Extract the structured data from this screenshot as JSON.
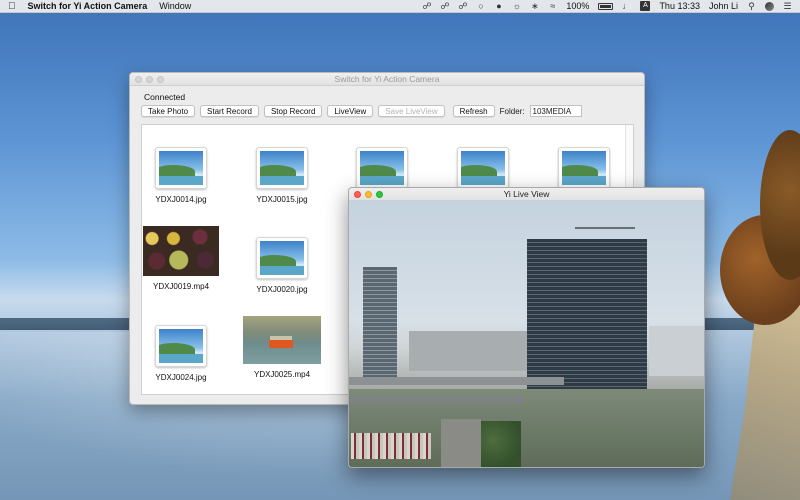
{
  "menubar": {
    "apple_icon": "apple-icon",
    "app_name": "Switch for Yi Action Camera",
    "menus": [
      "Window"
    ],
    "battery_percent": "100%",
    "clock": "Thu 13:33",
    "user": "John Li",
    "input_source": "A"
  },
  "main_window": {
    "title": "Switch for Yi Action Camera",
    "status": "Connected",
    "buttons": {
      "take_photo": "Take Photo",
      "start_record": "Start Record",
      "stop_record": "Stop Record",
      "live_view": "LiveView",
      "save_live_view": "Save LiveView",
      "refresh": "Refresh"
    },
    "folder_label": "Folder:",
    "folder_value": "103MEDIA",
    "files": [
      {
        "name": "YDXJ0014.jpg",
        "kind": "image-icon"
      },
      {
        "name": "YDXJ0015.jpg",
        "kind": "image-icon"
      },
      {
        "name": "",
        "kind": "image-icon"
      },
      {
        "name": "",
        "kind": "image-icon"
      },
      {
        "name": "",
        "kind": "image-icon"
      },
      {
        "name": "YDXJ0019.mp4",
        "kind": "photo-grapes"
      },
      {
        "name": "YDXJ0020.jpg",
        "kind": "image-icon"
      },
      {
        "name": "YDXJ0024.jpg",
        "kind": "image-icon"
      },
      {
        "name": "YDXJ0025.mp4",
        "kind": "photo-boat"
      }
    ]
  },
  "live_window": {
    "title": "Yi Live View"
  },
  "colors": {
    "close": "#fc5f57",
    "minimize": "#fdbc2e",
    "maximize": "#29c840"
  }
}
